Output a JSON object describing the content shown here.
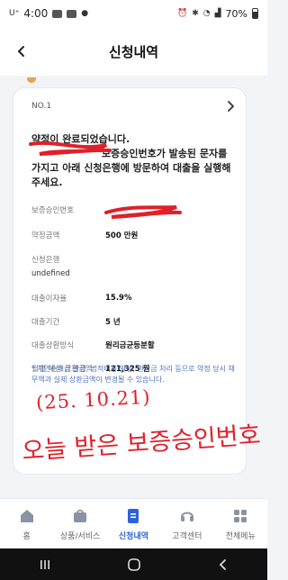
{
  "status": {
    "time": "4:00",
    "battery": "70%"
  },
  "header": {
    "title": "신청내역",
    "back_icon": "chevron-left-icon"
  },
  "card": {
    "number": "NO.1",
    "notice_line1": "약정이 완료되었습니다.",
    "notice_line2": "보증승인번호가 발송된 문자를",
    "notice_line3": "가지고 아래 신청은행에 방문하여 대출을 실행해",
    "notice_line4": "주세요.",
    "rows": {
      "approval_label": "보증승인번호",
      "amount_label": "약정금액",
      "amount_value": "500 만원",
      "bank_label": "신청은행",
      "bank_value": "undefined",
      "rate_label": "대출이자율",
      "rate_value": "15.9%",
      "period_label": "대출기간",
      "period_value": "5 년",
      "method_label": "대출상환방식",
      "method_value": "원리금균등분할",
      "monthly_label": "월별 예상 상환금액",
      "monthly_value": "121,325 원"
    },
    "footnote": "* 지연손해금 발생, 법적비용 발생, 환급금 처리 등으로 약정 당시 채무액과 실제 상환금액이 변경될 수 있습니다."
  },
  "handwriting": {
    "date": "(25. 10.21)",
    "note": "오늘 받은 보증승인번호"
  },
  "tabs": [
    {
      "label": "홈",
      "icon": "home-icon"
    },
    {
      "label": "상품/서비스",
      "icon": "bag-icon"
    },
    {
      "label": "신청내역",
      "icon": "document-icon"
    },
    {
      "label": "고객센터",
      "icon": "headset-icon"
    },
    {
      "label": "전체메뉴",
      "icon": "grid-icon"
    }
  ],
  "colors": {
    "accent": "#2b64d8",
    "scribble": "#e0202a",
    "footnote": "#4a74c4"
  }
}
